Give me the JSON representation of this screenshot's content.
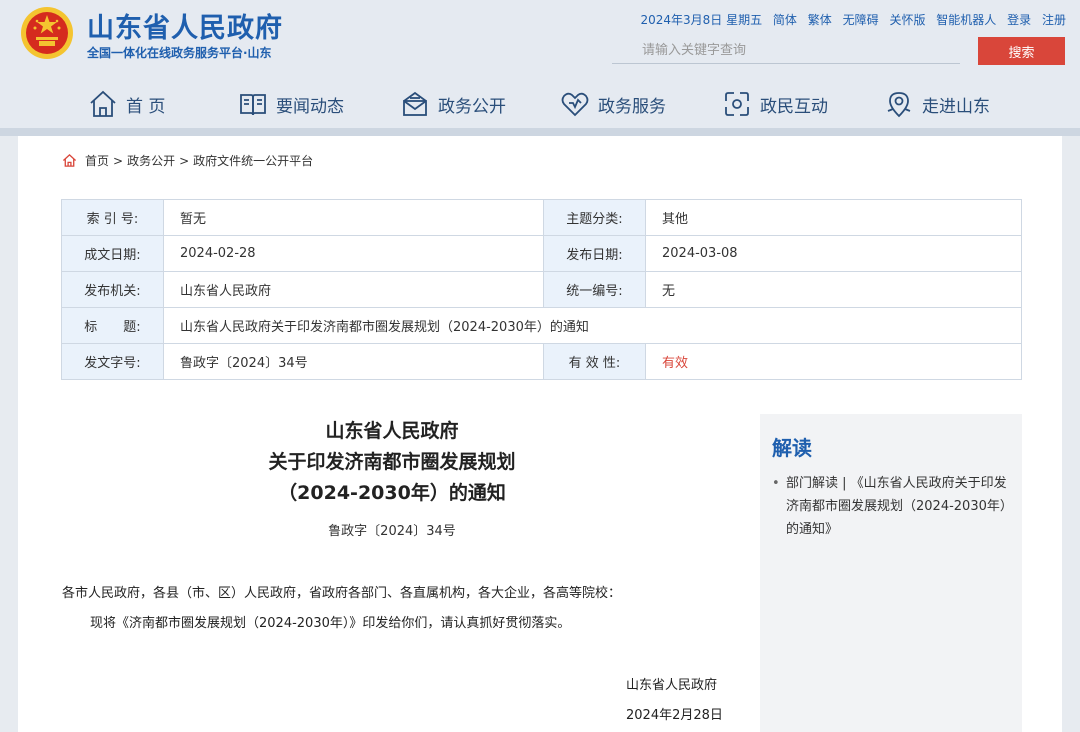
{
  "header": {
    "site_name": "山东省人民政府",
    "site_sub": "全国一体化在线政务服务平台·山东",
    "top_links": [
      "2024年3月8日 星期五",
      "简体",
      "繁体",
      "无障碍",
      "关怀版",
      "智能机器人",
      "登录",
      "注册"
    ],
    "search_placeholder": "请输入关键字查询",
    "search_button": "搜索"
  },
  "nav": {
    "items": [
      {
        "label": "首 页",
        "icon": "home-icon"
      },
      {
        "label": "要闻动态",
        "icon": "book-icon"
      },
      {
        "label": "政务公开",
        "icon": "mailbox-icon"
      },
      {
        "label": "政务服务",
        "icon": "heart-icon"
      },
      {
        "label": "政民互动",
        "icon": "interact-icon"
      },
      {
        "label": "走进山东",
        "icon": "map-pin-icon"
      }
    ]
  },
  "breadcrumb": {
    "items": [
      "首页",
      "政务公开",
      "政府文件统一公开平台"
    ],
    "separator": ">"
  },
  "meta": {
    "rows": [
      {
        "l1": "索 引 号:",
        "v1": "暂无",
        "l2": "主题分类:",
        "v2": "其他"
      },
      {
        "l1": "成文日期:",
        "v1": "2024-02-28",
        "l2": "发布日期:",
        "v2": "2024-03-08"
      },
      {
        "l1": "发布机关:",
        "v1": "山东省人民政府",
        "l2": "统一编号:",
        "v2": "无"
      },
      {
        "l1": "标　　题:",
        "v1": "山东省人民政府关于印发济南都市圈发展规划（2024-2030年）的通知"
      },
      {
        "l1": "发文字号:",
        "v1": "鲁政字〔2024〕34号",
        "l2": "有 效 性:",
        "v2": "有效"
      }
    ]
  },
  "document": {
    "title_lines": [
      "山东省人民政府",
      "关于印发济南都市圈发展规划",
      "（2024-2030年）的通知"
    ],
    "doc_no": "鲁政字〔2024〕34号",
    "para1": "各市人民政府，各县（市、区）人民政府，省政府各部门、各直属机构，各大企业，各高等院校：",
    "para2": "现将《济南都市圈发展规划（2024-2030年）》印发给你们，请认真抓好贯彻落实。",
    "sign_org": "山东省人民政府",
    "sign_date": "2024年2月28日"
  },
  "sidebar": {
    "title": "解读",
    "item": "部门解读 | 《山东省人民政府关于印发济南都市圈发展规划（2024-2030年）的通知》"
  },
  "colors": {
    "brand_blue": "#1f5fae",
    "accent_red": "#d9463a",
    "label_bg": "#eaf2fb"
  }
}
